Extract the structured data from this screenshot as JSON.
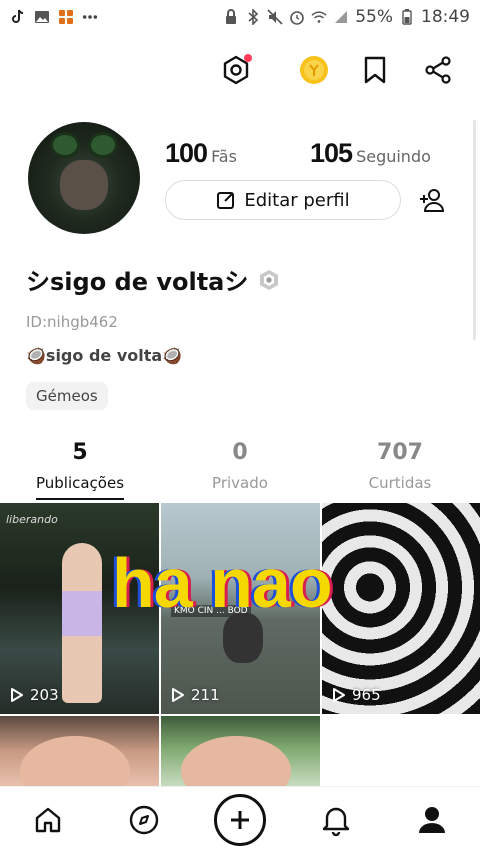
{
  "status_bar": {
    "battery_percent": "55%",
    "time": "18:49",
    "left_icons": [
      "tiktok-icon",
      "gallery-icon",
      "app-icon",
      "more-dots-icon"
    ],
    "right_icons": [
      "lock-icon",
      "bluetooth-icon",
      "mute-icon",
      "alarm-icon",
      "wifi-icon",
      "signal-icon",
      "battery-icon"
    ]
  },
  "top_actions": {
    "icons": [
      "settings-icon",
      "coin-icon",
      "bookmark-icon",
      "share-icon"
    ],
    "notification_dot_color": "#ff3b5c",
    "coin_color": "#f5b400"
  },
  "profile": {
    "fans_count": "100",
    "fans_label": "Fãs",
    "following_count": "105",
    "following_label": "Seguindo",
    "edit_button_label": "Editar perfil",
    "username": "シsigo de voltaシ",
    "user_id": "ID:nihgb462",
    "bio": "🥥sigo de volta🥥",
    "tag": "Gémeos"
  },
  "tabs": [
    {
      "count": "5",
      "label": "Publicações",
      "active": true
    },
    {
      "count": "0",
      "label": "Privado",
      "active": false
    },
    {
      "count": "707",
      "label": "Curtidas",
      "active": false
    }
  ],
  "grid": {
    "overlay_text": "ha nao",
    "watermark": "liberando",
    "caption": "KMO CIN ... BOD",
    "items": [
      {
        "views": "203"
      },
      {
        "views": "211"
      },
      {
        "views": "965"
      }
    ]
  },
  "bottom_nav": {
    "items": [
      "home-icon",
      "discover-icon",
      "create-icon",
      "notifications-icon",
      "profile-icon"
    ]
  }
}
